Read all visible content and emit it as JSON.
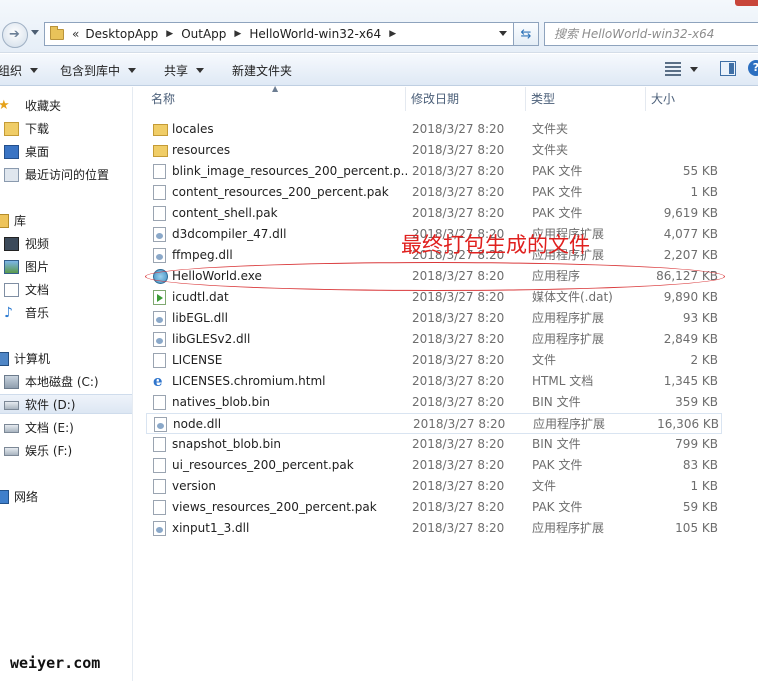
{
  "address_bar": {
    "breadcrumb_prefix": "«",
    "crumbs": [
      "DesktopApp",
      "OutApp",
      "HelloWorld-win32-x64"
    ],
    "search_placeholder": "搜索 HelloWorld-win32-x64"
  },
  "toolbar": {
    "organize": "组织",
    "include_in_library": "包含到库中",
    "share": "共享",
    "new_folder": "新建文件夹"
  },
  "nav": {
    "favorites": "收藏夹",
    "downloads": "下载",
    "desktop": "桌面",
    "recent": "最近访问的位置",
    "libraries": "库",
    "videos": "视频",
    "pictures": "图片",
    "documents": "文档",
    "music": "音乐",
    "computer": "计算机",
    "drive_c": "本地磁盘 (C:)",
    "drive_d": "软件 (D:)",
    "drive_e": "文档 (E:)",
    "drive_f": "娱乐 (F:)",
    "network": "网络"
  },
  "columns": {
    "name": "名称",
    "date": "修改日期",
    "type": "类型",
    "size": "大小"
  },
  "files": [
    {
      "name": "locales",
      "date": "2018/3/27 8:20",
      "type": "文件夹",
      "size": "",
      "icon": "folder-icon"
    },
    {
      "name": "resources",
      "date": "2018/3/27 8:20",
      "type": "文件夹",
      "size": "",
      "icon": "folder-icon"
    },
    {
      "name": "blink_image_resources_200_percent.p...",
      "date": "2018/3/27 8:20",
      "type": "PAK 文件",
      "size": "55 KB",
      "icon": "file-icon"
    },
    {
      "name": "content_resources_200_percent.pak",
      "date": "2018/3/27 8:20",
      "type": "PAK 文件",
      "size": "1 KB",
      "icon": "file-icon"
    },
    {
      "name": "content_shell.pak",
      "date": "2018/3/27 8:20",
      "type": "PAK 文件",
      "size": "9,619 KB",
      "icon": "file-icon"
    },
    {
      "name": "d3dcompiler_47.dll",
      "date": "2018/3/27 8:20",
      "type": "应用程序扩展",
      "size": "4,077 KB",
      "icon": "dll-icon"
    },
    {
      "name": "ffmpeg.dll",
      "date": "2018/3/27 8:20",
      "type": "应用程序扩展",
      "size": "2,207 KB",
      "icon": "dll-icon"
    },
    {
      "name": "HelloWorld.exe",
      "date": "2018/3/27 8:20",
      "type": "应用程序",
      "size": "86,127 KB",
      "icon": "exe-icon"
    },
    {
      "name": "icudtl.dat",
      "date": "2018/3/27 8:20",
      "type": "媒体文件(.dat)",
      "size": "9,890 KB",
      "icon": "media-file-icon"
    },
    {
      "name": "libEGL.dll",
      "date": "2018/3/27 8:20",
      "type": "应用程序扩展",
      "size": "93 KB",
      "icon": "dll-icon"
    },
    {
      "name": "libGLESv2.dll",
      "date": "2018/3/27 8:20",
      "type": "应用程序扩展",
      "size": "2,849 KB",
      "icon": "dll-icon"
    },
    {
      "name": "LICENSE",
      "date": "2018/3/27 8:20",
      "type": "文件",
      "size": "2 KB",
      "icon": "file-icon"
    },
    {
      "name": "LICENSES.chromium.html",
      "date": "2018/3/27 8:20",
      "type": "HTML 文档",
      "size": "1,345 KB",
      "icon": "html-icon"
    },
    {
      "name": "natives_blob.bin",
      "date": "2018/3/27 8:20",
      "type": "BIN 文件",
      "size": "359 KB",
      "icon": "file-icon"
    },
    {
      "name": "node.dll",
      "date": "2018/3/27 8:20",
      "type": "应用程序扩展",
      "size": "16,306 KB",
      "icon": "dll-icon"
    },
    {
      "name": "snapshot_blob.bin",
      "date": "2018/3/27 8:20",
      "type": "BIN 文件",
      "size": "799 KB",
      "icon": "file-icon"
    },
    {
      "name": "ui_resources_200_percent.pak",
      "date": "2018/3/27 8:20",
      "type": "PAK 文件",
      "size": "83 KB",
      "icon": "file-icon"
    },
    {
      "name": "version",
      "date": "2018/3/27 8:20",
      "type": "文件",
      "size": "1 KB",
      "icon": "file-icon"
    },
    {
      "name": "views_resources_200_percent.pak",
      "date": "2018/3/27 8:20",
      "type": "PAK 文件",
      "size": "59 KB",
      "icon": "file-icon"
    },
    {
      "name": "xinput1_3.dll",
      "date": "2018/3/27 8:20",
      "type": "应用程序扩展",
      "size": "105 KB",
      "icon": "dll-icon"
    }
  ],
  "annotation": {
    "text": "最终打包生成的文件",
    "color": "#e0201e"
  },
  "watermark": "weiyer.com"
}
